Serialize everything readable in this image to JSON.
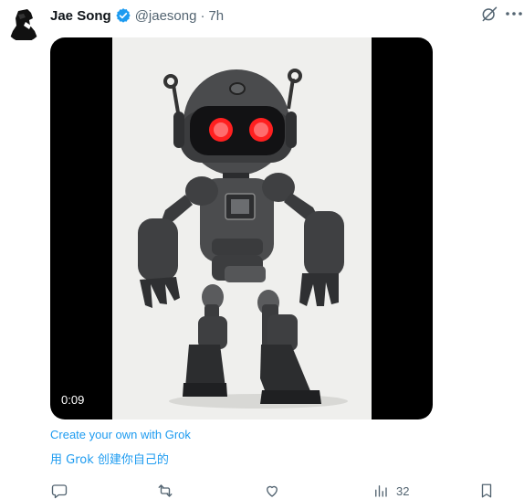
{
  "post": {
    "author_name": "Jae Song",
    "handle": "@jaesong",
    "separator": "·",
    "time": "7h",
    "video": {
      "duration": "0:09"
    },
    "grok_link_en": "Create your own with Grok",
    "grok_link_zh": "用 Grok 创建你自己的",
    "actions": {
      "views": "32"
    }
  },
  "icons": {
    "verified": "verified-badge-icon",
    "grok": "grok-icon",
    "more": "more-icon",
    "reply": "reply-icon",
    "repost": "repost-icon",
    "like": "like-icon",
    "views": "views-icon",
    "bookmark": "bookmark-icon"
  },
  "colors": {
    "accent": "#1d9bf0",
    "text": "#0f1419",
    "secondary": "#536471"
  }
}
